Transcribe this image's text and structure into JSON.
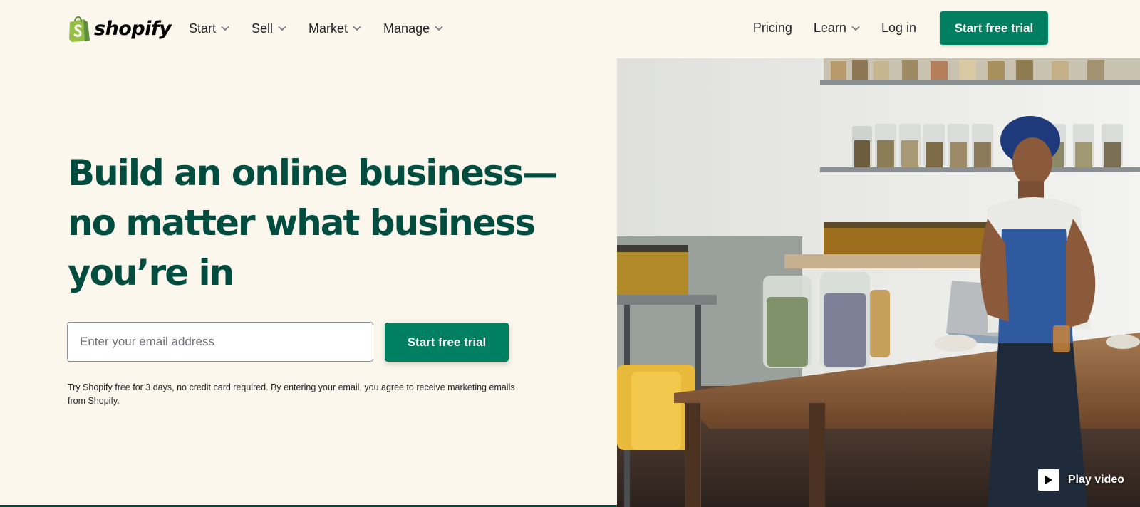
{
  "brand": {
    "name": "shopify",
    "accent": "#008060",
    "dark_green": "#004c3f",
    "logo_green": "#95bf47",
    "background": "#fbf7ed"
  },
  "nav": {
    "left": [
      {
        "label": "Start",
        "has_dropdown": true
      },
      {
        "label": "Sell",
        "has_dropdown": true
      },
      {
        "label": "Market",
        "has_dropdown": true
      },
      {
        "label": "Manage",
        "has_dropdown": true
      }
    ],
    "right": {
      "pricing": "Pricing",
      "learn": "Learn",
      "login": "Log in",
      "cta": "Start free trial"
    }
  },
  "hero": {
    "headline_lines": [
      "Build an online business—",
      "no matter what business",
      "you’re in"
    ],
    "email_placeholder": "Enter your email address",
    "cta": "Start free trial",
    "disclaimer": "Try Shopify free for 3 days, no credit card required. By entering your email, you agree to receive marketing emails from Shopify.",
    "play_label": "Play video"
  },
  "icons": [
    "shopify-bag-icon",
    "chevron-down-icon",
    "play-icon"
  ]
}
